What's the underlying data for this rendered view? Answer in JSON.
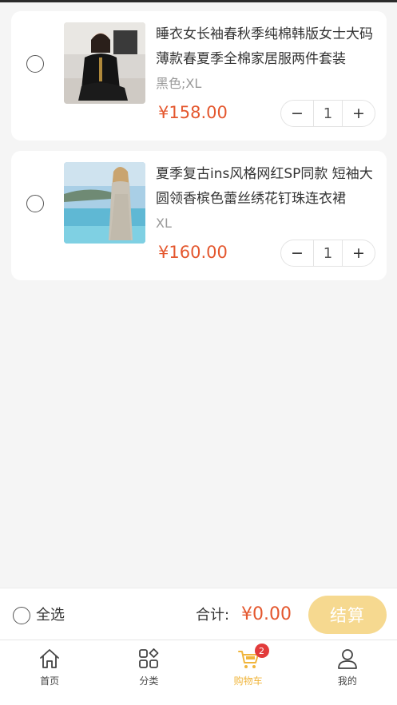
{
  "cart": {
    "items": [
      {
        "title": "睡衣女长袖春秋季纯棉韩版女士大码薄款春夏季全棉家居服两件套装",
        "spec": "黑色;XL",
        "price": "¥158.00",
        "quantity": "1",
        "thumbnail_icon": "pajamas-photo"
      },
      {
        "title": "夏季复古ins风格网红SP同款 短袖大圆领香槟色蕾丝绣花钉珠连衣裙",
        "spec": "XL",
        "price": "¥160.00",
        "quantity": "1",
        "thumbnail_icon": "dress-photo"
      }
    ],
    "minus_label": "−",
    "plus_label": "+"
  },
  "checkout": {
    "select_all_label": "全选",
    "total_label": "合计:",
    "total_value": "¥0.00",
    "button_label": "结算"
  },
  "tabbar": {
    "tabs": [
      {
        "label": "首页",
        "icon": "home-icon"
      },
      {
        "label": "分类",
        "icon": "category-icon"
      },
      {
        "label": "购物车",
        "icon": "cart-icon",
        "badge": "2"
      },
      {
        "label": "我的",
        "icon": "user-icon"
      }
    ]
  },
  "colors": {
    "accent": "#e4572e",
    "checkout_button": "#f6d990",
    "active_tab": "#f0b53c",
    "badge": "#e23b3b"
  }
}
